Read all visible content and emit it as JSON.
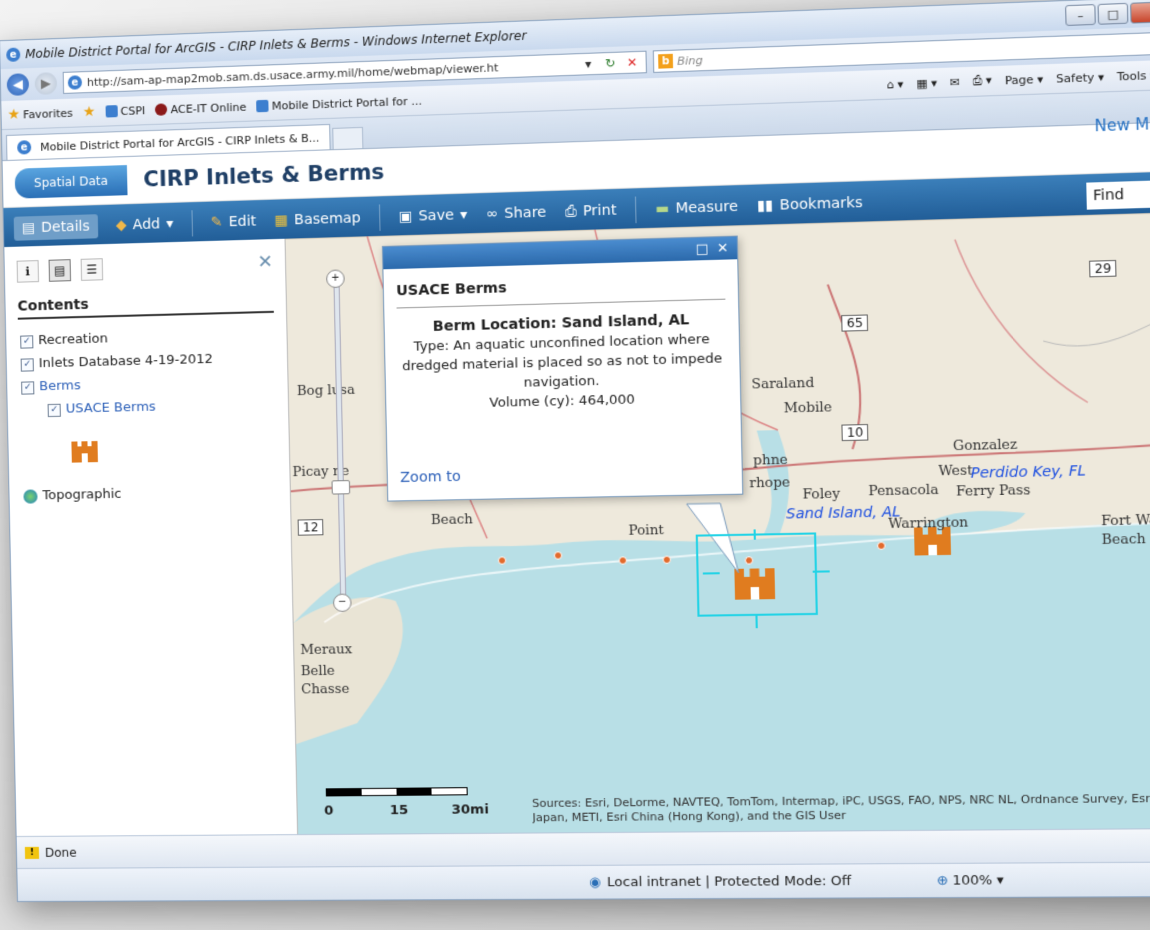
{
  "window": {
    "title": "Mobile District Portal for ArcGIS - CIRP Inlets & Berms - Windows Internet Explorer",
    "minimize": "–",
    "maximize": "□",
    "close": "x"
  },
  "address": {
    "url": "http://sam-ap-map2mob.sam.ds.usace.army.mil/home/webmap/viewer.ht",
    "search_placeholder": "Bing"
  },
  "favorites": {
    "label": "Favorites",
    "items": [
      "CSPI",
      "ACE-IT Online",
      "Mobile District Portal for ..."
    ],
    "commands": [
      "Page ▾",
      "Safety ▾",
      "Tools ▾"
    ]
  },
  "tab": {
    "title": "Mobile District Portal for ArcGIS - CIRP Inlets & B..."
  },
  "header": {
    "logo": "Spatial Data",
    "title": "CIRP Inlets & Berms",
    "new_map": "New Map"
  },
  "toolbar": {
    "details": "Details",
    "add": "Add",
    "edit": "Edit",
    "basemap": "Basemap",
    "save": "Save",
    "share": "Share",
    "print": "Print",
    "measure": "Measure",
    "bookmarks": "Bookmarks",
    "find": "Find"
  },
  "contents": {
    "heading": "Contents",
    "layers": [
      {
        "label": "Recreation",
        "checked": true
      },
      {
        "label": "Inlets Database 4-19-2012",
        "checked": true
      },
      {
        "label": "Berms",
        "checked": true
      },
      {
        "label": "USACE Berms",
        "checked": true
      },
      {
        "label": "Topographic"
      }
    ]
  },
  "popup": {
    "title": "USACE Berms",
    "location_label": "Berm Location:",
    "location_value": "Sand Island, AL",
    "type_label": "Type:",
    "type_value": "An aquatic unconfined location where dredged material is placed so as not to impede navigation.",
    "volume_label": "Volume (cy):",
    "volume_value": "464,000",
    "zoom_to": "Zoom to"
  },
  "map": {
    "places": {
      "bogalusa": "Bog lusa",
      "saraland": "Saraland",
      "mobile": "Mobile",
      "picayune": "Picay ne",
      "daphne": "phne",
      "fairhope": "rhope",
      "foley": "Foley",
      "pensacola": "Pensacola",
      "west": "West",
      "gonzalez": "Gonzalez",
      "ferry_pass": "Ferry Pass",
      "beach": "Beach",
      "point": "Point",
      "warrington": "Warrington",
      "fort_walton": "Fort Walton Beach",
      "meraux": "Meraux",
      "belle_chasse": "Belle Chasse"
    },
    "blue_labels": {
      "perdido": "Perdido Key, FL",
      "sand_island": "Sand Island, AL"
    },
    "highways": {
      "h29": "29",
      "h65": "65",
      "h10": "10",
      "h12": "12"
    },
    "scale": {
      "s0": "0",
      "s15": "15",
      "s30": "30mi"
    },
    "attribution": "Sources: Esri, DeLorme, NAVTEQ, TomTom, Intermap, iPC, USGS, FAO, NPS, NRC NL, Ordnance Survey, Esri Japan, METI, Esri China (Hong Kong), and the GIS User"
  },
  "status": {
    "done": "Done",
    "zone": "Local intranet | Protected Mode: Off",
    "zoom": "100%"
  }
}
